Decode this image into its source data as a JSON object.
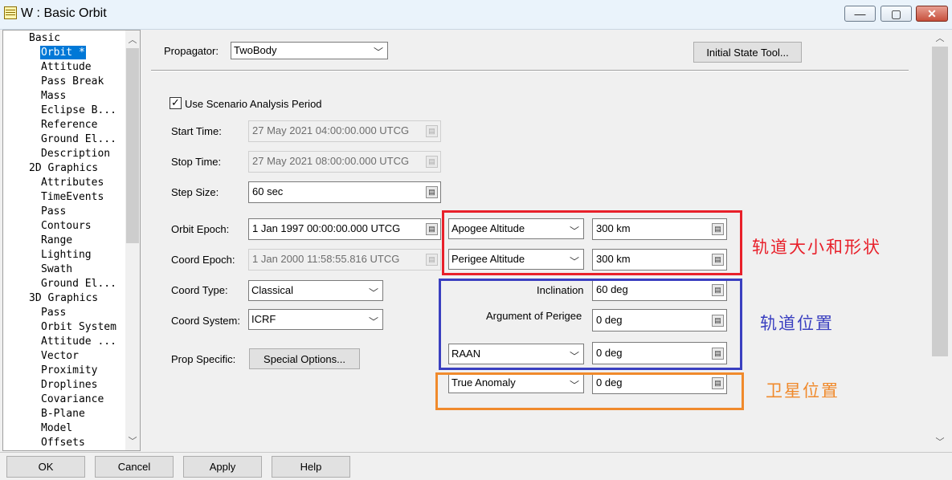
{
  "window": {
    "title": "W : Basic Orbit",
    "controls": {
      "minimize": "—",
      "maximize": "▢",
      "close": "✕"
    }
  },
  "tree": {
    "items": [
      {
        "label": "Basic",
        "level": 0
      },
      {
        "label": "Orbit *",
        "level": 1,
        "selected": true
      },
      {
        "label": "Attitude",
        "level": 1
      },
      {
        "label": "Pass Break",
        "level": 1
      },
      {
        "label": "Mass",
        "level": 1
      },
      {
        "label": "Eclipse B...",
        "level": 1
      },
      {
        "label": "Reference",
        "level": 1
      },
      {
        "label": "Ground El...",
        "level": 1
      },
      {
        "label": "Description",
        "level": 1
      },
      {
        "label": "2D Graphics",
        "level": 0
      },
      {
        "label": "Attributes",
        "level": 1
      },
      {
        "label": "TimeEvents",
        "level": 1
      },
      {
        "label": "Pass",
        "level": 1
      },
      {
        "label": "Contours",
        "level": 1
      },
      {
        "label": "Range",
        "level": 1
      },
      {
        "label": "Lighting",
        "level": 1
      },
      {
        "label": "Swath",
        "level": 1
      },
      {
        "label": "Ground El...",
        "level": 1
      },
      {
        "label": "3D Graphics",
        "level": 0
      },
      {
        "label": "Pass",
        "level": 1
      },
      {
        "label": "Orbit System",
        "level": 1
      },
      {
        "label": "Attitude ...",
        "level": 1
      },
      {
        "label": "Vector",
        "level": 1
      },
      {
        "label": "Proximity",
        "level": 1
      },
      {
        "label": "Droplines",
        "level": 1
      },
      {
        "label": "Covariance",
        "level": 1
      },
      {
        "label": "B-Plane",
        "level": 1
      },
      {
        "label": "Model",
        "level": 1
      },
      {
        "label": "Offsets",
        "level": 1
      }
    ]
  },
  "propagator": {
    "label": "Propagator:",
    "value": "TwoBody"
  },
  "initial_state_button": "Initial State Tool...",
  "use_scenario": {
    "label": "Use Scenario Analysis Period",
    "checked": true
  },
  "start_time": {
    "label": "Start Time:",
    "value": "27 May 2021 04:00:00.000 UTCG"
  },
  "stop_time": {
    "label": "Stop Time:",
    "value": "27 May 2021 08:00:00.000 UTCG"
  },
  "step_size": {
    "label": "Step Size:",
    "value": "60 sec"
  },
  "orbit_epoch": {
    "label": "Orbit Epoch:",
    "value": "1 Jan 1997 00:00:00.000 UTCG"
  },
  "coord_epoch": {
    "label": "Coord Epoch:",
    "value": "1 Jan 2000 11:58:55.816 UTCG"
  },
  "coord_type": {
    "label": "Coord Type:",
    "value": "Classical"
  },
  "coord_system": {
    "label": "Coord System:",
    "value": "ICRF"
  },
  "prop_specific": {
    "label": "Prop Specific:",
    "button": "Special Options..."
  },
  "elements": {
    "apogee": {
      "selector": "Apogee Altitude",
      "value": "300 km"
    },
    "perigee": {
      "selector": "Perigee Altitude",
      "value": "300 km"
    },
    "inclination": {
      "label": "Inclination",
      "value": "60 deg"
    },
    "arg_perigee": {
      "label": "Argument of Perigee",
      "value": "0 deg"
    },
    "raan": {
      "selector": "RAAN",
      "value": "0 deg"
    },
    "true_anomaly": {
      "selector": "True Anomaly",
      "value": "0 deg"
    }
  },
  "annotations": {
    "size_shape": {
      "text": "轨道大小和形状",
      "color": "#e8202a"
    },
    "orientation": {
      "text": "轨道位置",
      "color": "#3a3fc0"
    },
    "position": {
      "text": "卫星位置",
      "color": "#f08a2c"
    }
  },
  "buttons": {
    "ok": "OK",
    "cancel": "Cancel",
    "apply": "Apply",
    "help": "Help"
  },
  "icons": {
    "unit": "unit-picker-icon",
    "dropdown": "chevron-down-icon"
  }
}
